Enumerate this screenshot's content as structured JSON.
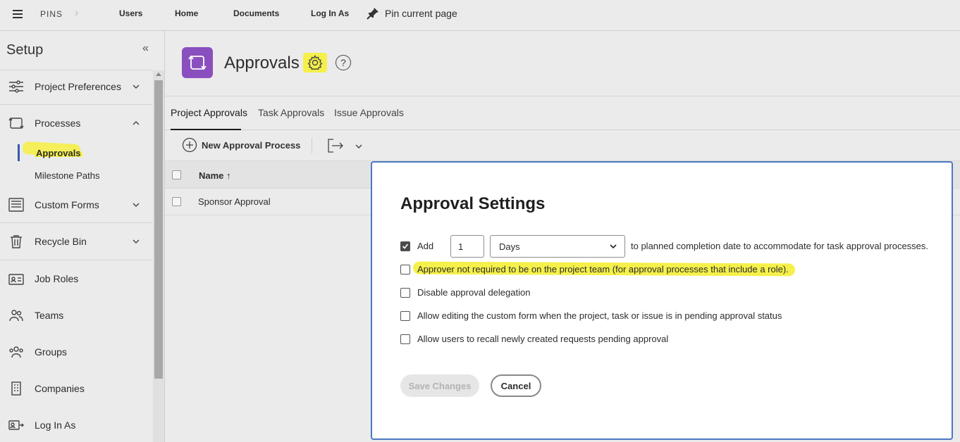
{
  "topbar": {
    "brand": "PINS",
    "nav": [
      "Users",
      "Home",
      "Documents",
      "Log In As"
    ],
    "pin_label": "Pin current page"
  },
  "sidebar": {
    "title": "Setup",
    "items": [
      {
        "label": "Project Preferences",
        "icon": "sliders-icon",
        "expandable": true
      },
      {
        "label": "Processes",
        "icon": "process-icon",
        "expandable": true,
        "expanded": true
      },
      {
        "label": "Custom Forms",
        "icon": "form-icon",
        "expandable": true
      },
      {
        "label": "Recycle Bin",
        "icon": "trash-icon",
        "expandable": true
      },
      {
        "label": "Job Roles",
        "icon": "id-card-icon"
      },
      {
        "label": "Teams",
        "icon": "teams-icon"
      },
      {
        "label": "Groups",
        "icon": "groups-icon"
      },
      {
        "label": "Companies",
        "icon": "building-icon"
      },
      {
        "label": "Log In As",
        "icon": "login-icon"
      }
    ],
    "subitems": [
      {
        "label": "Approvals",
        "active": true
      },
      {
        "label": "Milestone Paths"
      }
    ]
  },
  "main": {
    "title": "Approvals",
    "tabs": [
      "Project Approvals",
      "Task Approvals",
      "Issue Approvals"
    ],
    "new_button": "New Approval Process",
    "table": {
      "column": "Name ↑",
      "rows": [
        "Sponsor Approval"
      ]
    }
  },
  "modal": {
    "title": "Approval Settings",
    "add_label": "Add",
    "add_value": "1",
    "unit_selected": "Days",
    "add_suffix": "to planned completion date to accommodate for task approval processes.",
    "options": [
      {
        "label": "Approver not required to be on the project team (for approval processes that include a role).",
        "checked": false
      },
      {
        "label": "Disable approval delegation",
        "checked": false
      },
      {
        "label": "Allow editing the custom form when the project, task or issue is in pending approval status",
        "checked": false
      },
      {
        "label": "Allow users to recall newly created requests pending approval",
        "checked": false
      }
    ],
    "save_label": "Save Changes",
    "cancel_label": "Cancel"
  },
  "colors": {
    "accent_purple": "#8a4fbf",
    "modal_border": "#4a78c2",
    "highlight": "#f5f04a",
    "active_bar": "#3a5aa8"
  }
}
